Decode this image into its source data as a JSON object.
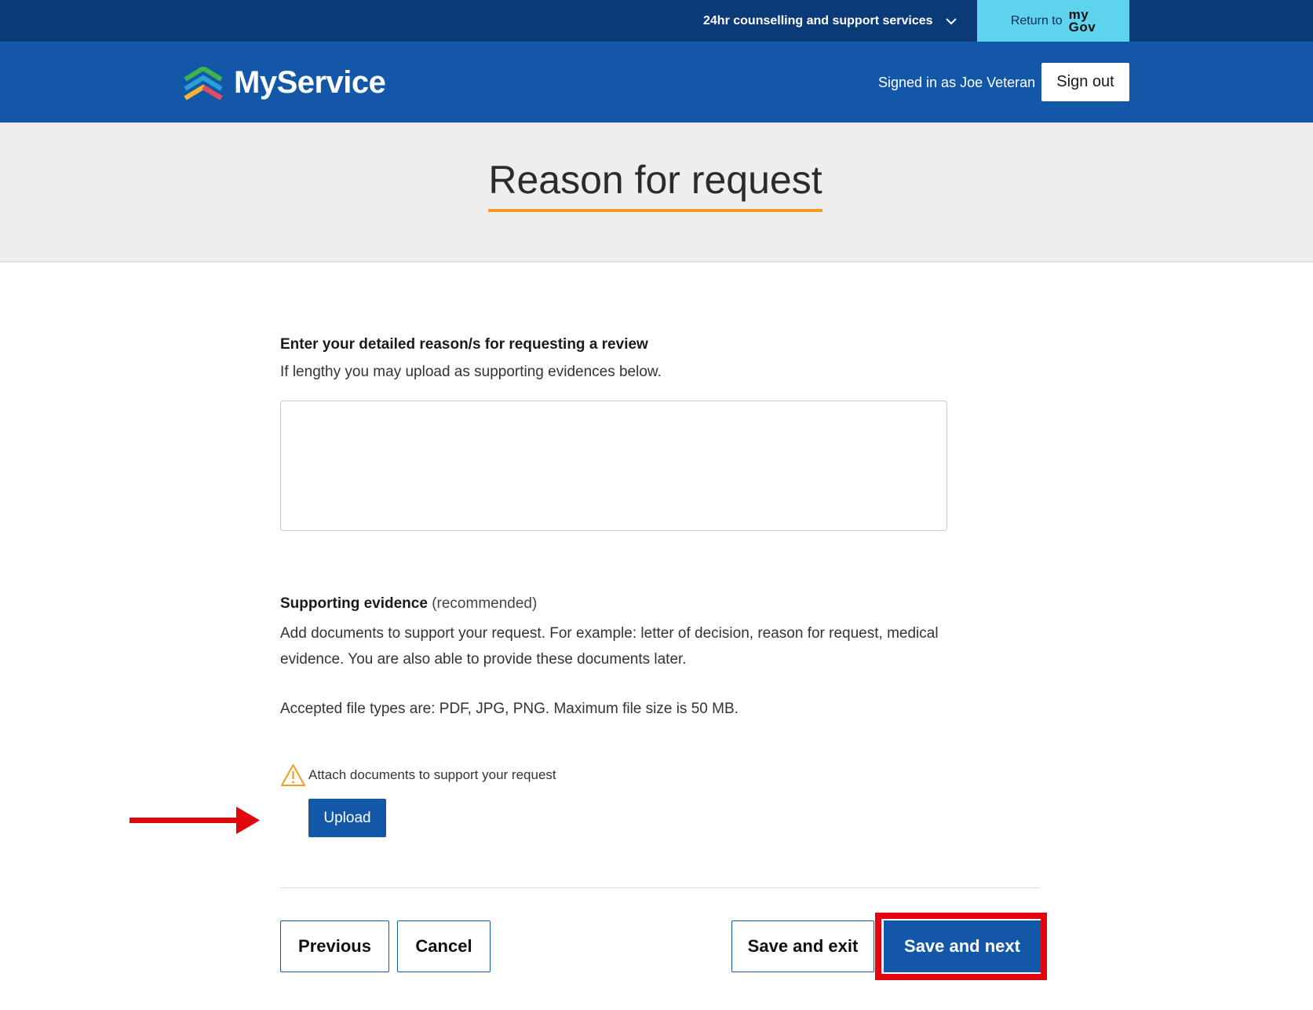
{
  "utility_bar": {
    "support_label": "24hr counselling and support services",
    "return_label": "Return to",
    "mygov_logo_line1": "my",
    "mygov_logo_line2": "Gov"
  },
  "header": {
    "brand_name": "MyService",
    "signed_in_text": "Signed in as Joe Veteran",
    "sign_out_label": "Sign out"
  },
  "page": {
    "title": "Reason for request"
  },
  "reason": {
    "label": "Enter your detailed reason/s for requesting a review",
    "hint": "If lengthy you may upload as supporting evidences below.",
    "value": ""
  },
  "evidence": {
    "title": "Supporting evidence",
    "title_suffix": "(recommended)",
    "description": "Add documents to support your request. For example: letter of decision, reason for request, medical evidence. You are also able to provide these documents later.",
    "file_types": "Accepted file types are: PDF, JPG, PNG. Maximum file size is 50 MB.",
    "warning_text": "Attach documents to support your request",
    "upload_label": "Upload"
  },
  "footer_buttons": {
    "previous": "Previous",
    "cancel": "Cancel",
    "save_exit": "Save and exit",
    "save_next": "Save and next"
  },
  "colors": {
    "top_bar": "#0a3b78",
    "header": "#1257a8",
    "mygov_button": "#5ed3ee",
    "title_underline": "#f39c1f",
    "annotation_red": "#e3060e"
  }
}
